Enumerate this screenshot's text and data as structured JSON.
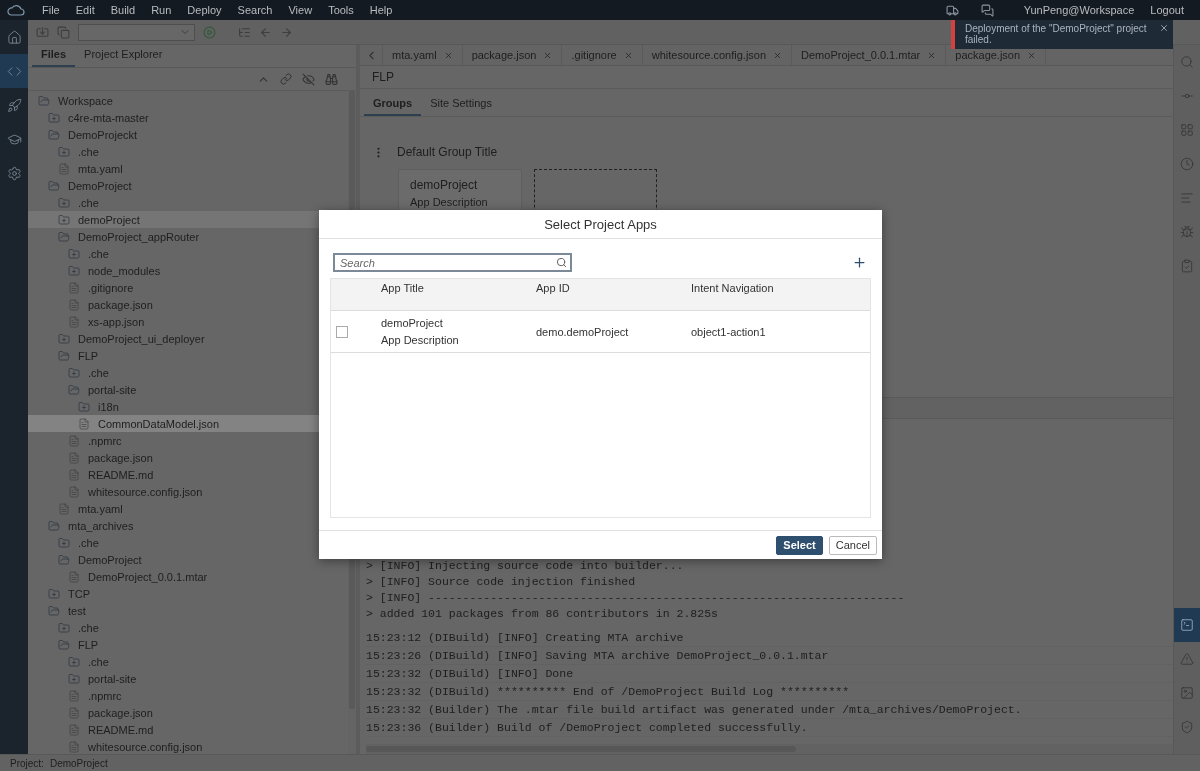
{
  "menu_bar": {
    "items": [
      "File",
      "Edit",
      "Build",
      "Run",
      "Deploy",
      "Search",
      "View",
      "Tools",
      "Help"
    ],
    "user": "YunPeng@Workspace",
    "logout": "Logout"
  },
  "left_rail": [
    {
      "kind": "home",
      "selected": false
    },
    {
      "kind": "code",
      "selected": true
    },
    {
      "kind": "rocket",
      "selected": false
    },
    {
      "kind": "learn",
      "selected": false
    },
    {
      "kind": "settings",
      "selected": false
    }
  ],
  "explorer": {
    "tabs": [
      {
        "label": "Files",
        "selected": true
      },
      {
        "label": "Project Explorer",
        "selected": false
      }
    ],
    "tree": [
      {
        "name": "Workspace",
        "kind": "folder",
        "expanded": true,
        "selected": false,
        "hovered": false,
        "children": [
          {
            "name": "c4re-mta-master",
            "kind": "folder",
            "expanded": false,
            "selected": false,
            "hovered": false
          },
          {
            "name": "DemoProjeckt",
            "kind": "folder",
            "expanded": true,
            "selected": false,
            "hovered": false,
            "children": [
              {
                "name": ".che",
                "kind": "folder",
                "expanded": false,
                "selected": false,
                "hovered": false
              },
              {
                "name": "mta.yaml",
                "kind": "file",
                "selected": false,
                "hovered": false
              }
            ]
          },
          {
            "name": "DemoProject",
            "kind": "folder",
            "expanded": true,
            "selected": false,
            "hovered": false,
            "children": [
              {
                "name": ".che",
                "kind": "folder",
                "expanded": false,
                "selected": false,
                "hovered": false
              },
              {
                "name": "demoProject",
                "kind": "folder",
                "expanded": false,
                "selected": false,
                "hovered": true
              },
              {
                "name": "DemoProject_appRouter",
                "kind": "folder",
                "expanded": true,
                "selected": false,
                "hovered": false,
                "children": [
                  {
                    "name": ".che",
                    "kind": "folder",
                    "expanded": false,
                    "selected": false,
                    "hovered": false
                  },
                  {
                    "name": "node_modules",
                    "kind": "folder",
                    "expanded": false,
                    "selected": false,
                    "hovered": false
                  },
                  {
                    "name": ".gitignore",
                    "kind": "file",
                    "selected": false,
                    "hovered": false
                  },
                  {
                    "name": "package.json",
                    "kind": "file",
                    "selected": false,
                    "hovered": false
                  },
                  {
                    "name": "xs-app.json",
                    "kind": "file",
                    "selected": false,
                    "hovered": false
                  }
                ]
              },
              {
                "name": "DemoProject_ui_deployer",
                "kind": "folder",
                "expanded": false,
                "selected": false,
                "hovered": false
              },
              {
                "name": "FLP",
                "kind": "folder",
                "expanded": true,
                "selected": false,
                "hovered": false,
                "children": [
                  {
                    "name": ".che",
                    "kind": "folder",
                    "expanded": false,
                    "selected": false,
                    "hovered": false
                  },
                  {
                    "name": "portal-site",
                    "kind": "folder",
                    "expanded": true,
                    "selected": false,
                    "hovered": false,
                    "children": [
                      {
                        "name": "i18n",
                        "kind": "folder",
                        "expanded": false,
                        "selected": false,
                        "hovered": false
                      },
                      {
                        "name": "CommonDataModel.json",
                        "kind": "file",
                        "selected": true,
                        "hovered": false
                      }
                    ]
                  },
                  {
                    "name": ".npmrc",
                    "kind": "file",
                    "selected": false,
                    "hovered": false
                  },
                  {
                    "name": "package.json",
                    "kind": "file",
                    "selected": false,
                    "hovered": false
                  },
                  {
                    "name": "README.md",
                    "kind": "file",
                    "selected": false,
                    "hovered": false
                  },
                  {
                    "name": "whitesource.config.json",
                    "kind": "file",
                    "selected": false,
                    "hovered": false
                  }
                ]
              },
              {
                "name": "mta.yaml",
                "kind": "file",
                "selected": false,
                "hovered": false
              }
            ]
          },
          {
            "name": "mta_archives",
            "kind": "folder",
            "expanded": true,
            "selected": false,
            "hovered": false,
            "children": [
              {
                "name": ".che",
                "kind": "folder",
                "expanded": false,
                "selected": false,
                "hovered": false
              },
              {
                "name": "DemoProject",
                "kind": "folder",
                "expanded": true,
                "selected": false,
                "hovered": false,
                "children": [
                  {
                    "name": "DemoProject_0.0.1.mtar",
                    "kind": "file",
                    "selected": false,
                    "hovered": false
                  }
                ]
              }
            ]
          },
          {
            "name": "TCP",
            "kind": "folder",
            "expanded": false,
            "selected": false,
            "hovered": false
          },
          {
            "name": "test",
            "kind": "folder",
            "expanded": true,
            "selected": false,
            "hovered": false,
            "children": [
              {
                "name": ".che",
                "kind": "folder",
                "expanded": false,
                "selected": false,
                "hovered": false
              },
              {
                "name": "FLP",
                "kind": "folder",
                "expanded": true,
                "selected": false,
                "hovered": false,
                "children": [
                  {
                    "name": ".che",
                    "kind": "folder",
                    "expanded": false,
                    "selected": false,
                    "hovered": false
                  },
                  {
                    "name": "portal-site",
                    "kind": "folder",
                    "expanded": false,
                    "selected": false,
                    "hovered": false
                  },
                  {
                    "name": ".npmrc",
                    "kind": "file",
                    "selected": false,
                    "hovered": false
                  },
                  {
                    "name": "package.json",
                    "kind": "file",
                    "selected": false,
                    "hovered": false
                  },
                  {
                    "name": "README.md",
                    "kind": "file",
                    "selected": false,
                    "hovered": false
                  },
                  {
                    "name": "whitesource.config.json",
                    "kind": "file",
                    "selected": false,
                    "hovered": false
                  }
                ]
              }
            ]
          }
        ]
      }
    ]
  },
  "editor_tabs": [
    {
      "label": "mta.yaml"
    },
    {
      "label": "package.json"
    },
    {
      "label": ".gitignore"
    },
    {
      "label": "whitesource.config.json"
    },
    {
      "label": "DemoProject_0.0.1.mtar"
    },
    {
      "label": "package.json"
    }
  ],
  "flp_editor": {
    "title": "FLP",
    "tabs": [
      {
        "label": "Groups",
        "selected": true
      },
      {
        "label": "Site Settings",
        "selected": false
      }
    ],
    "group_title": "Default Group Title",
    "tile": {
      "title": "demoProject",
      "subtitle": "App Description"
    }
  },
  "console": {
    "groups": [
      [
        "> [INFO] Injecting source code into builder...",
        "> [INFO] Source code injection finished",
        "> [INFO] ---------------------------------------------------------------------",
        "> added 101 packages from 86 contributors in 2.825s"
      ],
      [
        "15:23:12 (DIBuild) [INFO] Creating MTA archive",
        "15:23:26 (DIBuild) [INFO] Saving MTA archive DemoProject_0.0.1.mtar",
        "15:23:32 (DIBuild) [INFO] Done",
        "15:23:32 (DIBuild) ********** End of /DemoProject Build Log **********",
        "15:23:32 (Builder) The .mtar file build artifact was generated under /mta_archives/DemoProject.",
        "15:23:36 (Builder) Build of /DemoProject completed successfully."
      ]
    ]
  },
  "right_rail": {
    "top": [
      {
        "kind": "search",
        "selected": false
      },
      {
        "kind": "git",
        "selected": false
      },
      {
        "kind": "grid",
        "selected": false
      },
      {
        "kind": "history",
        "selected": false
      },
      {
        "kind": "outline",
        "selected": false
      },
      {
        "kind": "bug",
        "selected": false
      },
      {
        "kind": "clipboard",
        "selected": false
      }
    ],
    "bottom": [
      {
        "kind": "console",
        "selected": true
      },
      {
        "kind": "problems",
        "selected": false
      },
      {
        "kind": "preview",
        "selected": false
      },
      {
        "kind": "shield",
        "selected": false
      }
    ]
  },
  "status_bar": {
    "label": "Project:",
    "value": "DemoProject"
  },
  "notification": {
    "message": "Deployment of the \"DemoProject\" project failed."
  },
  "dialog": {
    "title": "Select Project Apps",
    "search": {
      "placeholder": "Search"
    },
    "columns": [
      "App Title",
      "App ID",
      "Intent Navigation"
    ],
    "rows": [
      {
        "checked": false,
        "title": "demoProject",
        "description": "App Description",
        "app_id": "demo.demoProject",
        "intent": "object1-action1"
      }
    ],
    "buttons": [
      {
        "label": "Select",
        "kind": "primary"
      },
      {
        "label": "Cancel",
        "kind": "secondary"
      }
    ]
  }
}
